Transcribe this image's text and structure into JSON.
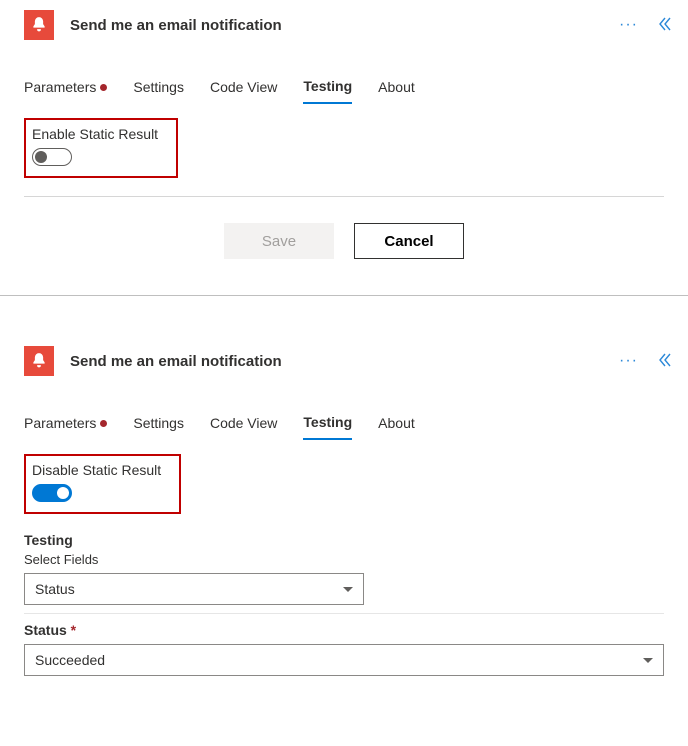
{
  "shared": {
    "title": "Send me an email notification",
    "tabs": {
      "parameters": "Parameters",
      "settings": "Settings",
      "codeview": "Code View",
      "testing": "Testing",
      "about": "About"
    },
    "buttons": {
      "save": "Save",
      "cancel": "Cancel"
    }
  },
  "panel1": {
    "toggle_label": "Enable Static Result",
    "toggle_on": false
  },
  "panel2": {
    "toggle_label": "Disable Static Result",
    "toggle_on": true,
    "testing_heading": "Testing",
    "select_fields_label": "Select Fields",
    "select_fields_value": "Status",
    "status_label": "Status",
    "status_value": "Succeeded"
  }
}
